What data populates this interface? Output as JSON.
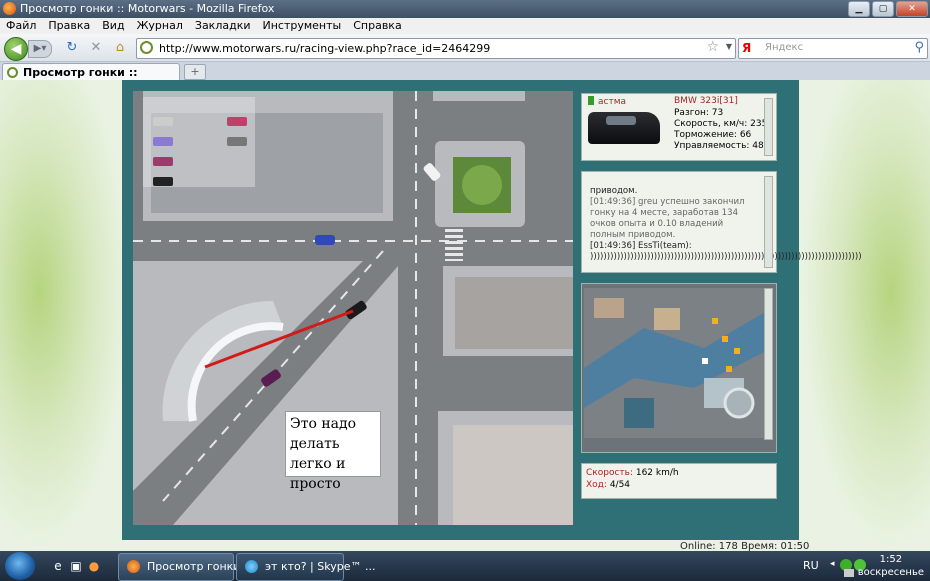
{
  "window": {
    "title": "Просмотр гонки :: Motorwars - Mozilla Firefox"
  },
  "menu": [
    "Файл",
    "Правка",
    "Вид",
    "Журнал",
    "Закладки",
    "Инструменты",
    "Справка"
  ],
  "nav": {
    "url": "http://www.motorwars.ru/racing-view.php?race_id=2464299",
    "search_engine": "Я",
    "search_placeholder": "Яндекс"
  },
  "tabs": [
    {
      "label": "Просмотр гонки :: Motorwars"
    }
  ],
  "overlay": {
    "note": "Это надо делать легко и просто"
  },
  "car": {
    "driver": "астма",
    "model": "BMW 323i[31]",
    "stats": [
      "Разгон: 73",
      "Скорость, км/ч: 235",
      "Торможение: 66",
      "Управляемость: 48"
    ]
  },
  "chat": {
    "lines": [
      "приводом.",
      "[01:49:36] greu успешно закончил гонку на 4 месте, заработав 134 очков опыта и 0.10 владений полным приводом.",
      "[01:49:36] EssTi(team):",
      ")))))))))))))))))))))))))))))))))))))))))))))))))))))))))))))))))))))))))))))))))"
    ]
  },
  "race": {
    "speed_label": "Скорость:",
    "speed_value": "162 km/h",
    "turn_label": "Ход:",
    "turn_value": "4/54"
  },
  "footer": {
    "online": "Online: 178",
    "time": "Время: 01:50"
  },
  "taskbar": {
    "items": [
      {
        "label": "Просмотр гонки..."
      },
      {
        "label": "эт кто? | Skype™ ..."
      }
    ],
    "lang": "RU",
    "time": "1:52",
    "day": "воскресенье"
  },
  "colors": {
    "frame": "#2f6f76",
    "road": "#7c7f82",
    "accent_red": "#b02020"
  }
}
